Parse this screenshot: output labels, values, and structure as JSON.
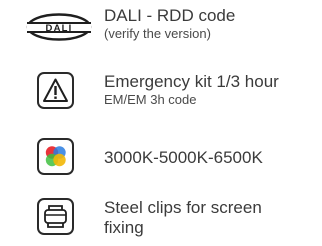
{
  "features": [
    {
      "icon": "dali-logo-icon",
      "label": "DALI - RDD code",
      "sublabel": "(verify the version)",
      "logo_text": "DALI"
    },
    {
      "icon": "warning-triangle-icon",
      "label": "Emergency kit 1/3 hour",
      "sublabel": "EM/EM 3h code"
    },
    {
      "icon": "color-temperature-icon",
      "label": "3000K-5000K-6500K",
      "colors": [
        "#e8232a",
        "#2a7de1",
        "#3fbf3f",
        "#f2b705"
      ]
    },
    {
      "icon": "steel-clip-icon",
      "label": "Steel clips for screen",
      "label_line2": "fixing"
    }
  ]
}
